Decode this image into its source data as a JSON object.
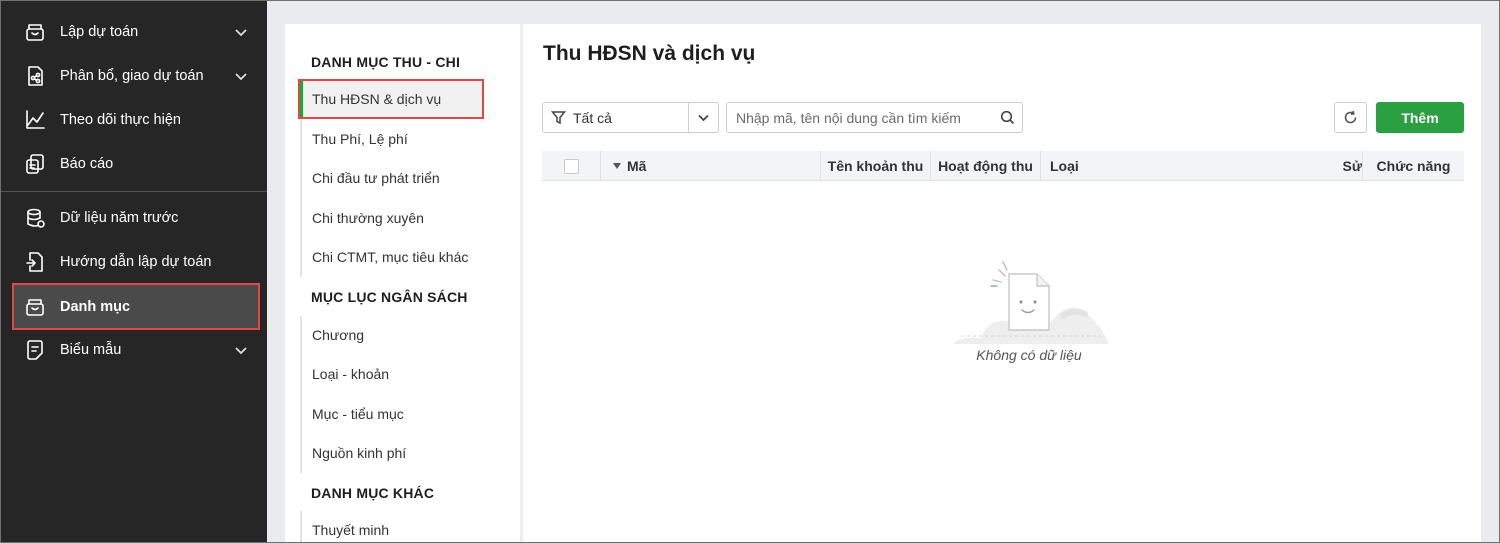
{
  "sidebar": {
    "items": [
      {
        "label": "Lập dự toán",
        "icon": "archive-icon",
        "expandable": true
      },
      {
        "label": "Phân bổ, giao dự toán",
        "icon": "share-document-icon",
        "expandable": true
      },
      {
        "label": "Theo dõi thực hiện",
        "icon": "line-chart-icon",
        "expandable": false
      },
      {
        "label": "Báo cáo",
        "icon": "report-icon",
        "expandable": false
      },
      {
        "label": "Dữ liệu năm trước",
        "icon": "database-icon",
        "expandable": false
      },
      {
        "label": "Hướng dẫn lập dự toán",
        "icon": "guide-document-icon",
        "expandable": false
      },
      {
        "label": "Danh mục",
        "icon": "archive-icon",
        "expandable": false,
        "active": true
      },
      {
        "label": "Biểu mẫu",
        "icon": "form-icon",
        "expandable": true
      }
    ]
  },
  "categories": {
    "groups": [
      {
        "title": "DANH MỤC THU - CHI",
        "items": [
          "Thu HĐSN & dịch vụ",
          "Thu Phí, Lệ phí",
          "Chi đầu tư phát triển",
          "Chi thường xuyên",
          "Chi CTMT, mục tiêu khác"
        ]
      },
      {
        "title": "MỤC LỤC NGÂN SÁCH",
        "items": [
          "Chương",
          "Loại - khoản",
          "Mục - tiểu mục",
          "Nguồn kinh phí"
        ]
      },
      {
        "title": "DANH MỤC KHÁC",
        "items": [
          "Thuyết minh"
        ]
      }
    ],
    "selected": "Thu HĐSN & dịch vụ"
  },
  "main": {
    "title": "Thu HĐSN và dịch vụ",
    "filter_value": "Tất cả",
    "search_placeholder": "Nhập mã, tên nội dung cần tìm kiếm",
    "add_label": "Thêm",
    "columns": [
      "Mã",
      "Tên khoản thu",
      "Hoạt động thu",
      "Loại",
      "Sử",
      "Chức năng"
    ],
    "empty_text": "Không có dữ liệu"
  },
  "colors": {
    "accent": "#2aa042",
    "sidebar_bg": "#262626",
    "highlight": "#e24646"
  }
}
